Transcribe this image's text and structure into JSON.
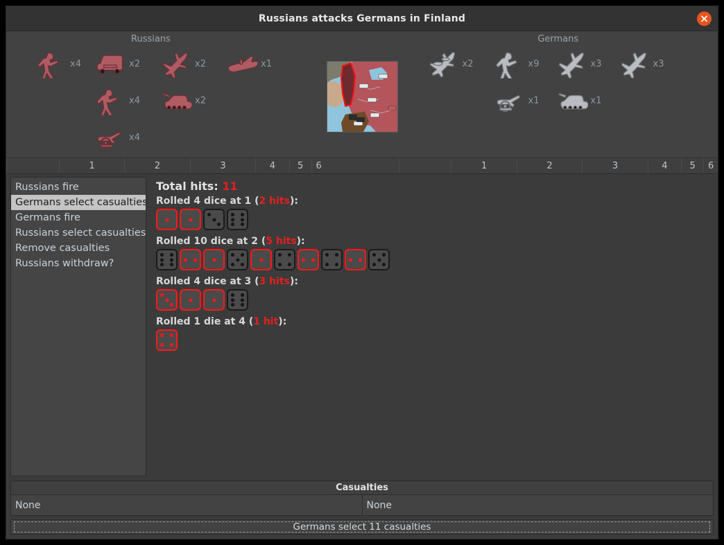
{
  "window": {
    "title": "Russians attacks Germans in Finland",
    "close_icon": "close-icon",
    "close_color": "#e8541f"
  },
  "board": {
    "attacker": {
      "name": "Russians",
      "color": "#b05b62",
      "units": [
        {
          "icon": "infantry-icon",
          "count": "x4",
          "col": 0,
          "row": 0
        },
        {
          "icon": "artillery-truck-icon",
          "count": "x2",
          "col": 1,
          "row": 0
        },
        {
          "icon": "fighter-icon",
          "count": "x2",
          "col": 2,
          "row": 0
        },
        {
          "icon": "submarine-icon",
          "count": "x1",
          "col": 3,
          "row": 0
        },
        {
          "icon": "infantry-icon",
          "count": "x4",
          "col": 1,
          "row": 1
        },
        {
          "icon": "tank-icon",
          "count": "x2",
          "col": 2,
          "row": 1
        },
        {
          "icon": "artillery-icon",
          "count": "x4",
          "col": 1,
          "row": 2
        }
      ]
    },
    "defender": {
      "name": "Germans",
      "color": "#b9bcc0",
      "units": [
        {
          "icon": "bomber-icon",
          "count": "x2",
          "col": 0,
          "row": 0
        },
        {
          "icon": "infantry-icon",
          "count": "x9",
          "col": 1,
          "row": 0
        },
        {
          "icon": "fighter-icon",
          "count": "x3",
          "col": 2,
          "row": 0
        },
        {
          "icon": "fighter-icon",
          "count": "x3",
          "col": 3,
          "row": 0
        },
        {
          "icon": "artillery-icon",
          "count": "x1",
          "col": 1,
          "row": 1
        },
        {
          "icon": "tank-icon",
          "count": "x1",
          "col": 2,
          "row": 1
        }
      ]
    },
    "map_thumbnail": {
      "name": "battle-territory-map",
      "territory": "Finland"
    },
    "scale_labels": [
      "1",
      "2",
      "3",
      "4",
      "5",
      "6"
    ]
  },
  "steps": [
    {
      "label": "Russians fire",
      "selected": false
    },
    {
      "label": "Germans select casualties",
      "selected": true
    },
    {
      "label": "Germans fire",
      "selected": false
    },
    {
      "label": "Russians select casualties",
      "selected": false
    },
    {
      "label": "Remove casualties",
      "selected": false
    },
    {
      "label": "Russians withdraw?",
      "selected": false
    }
  ],
  "results": {
    "total_hits_label": "Total hits:",
    "total_hits_value": "11",
    "hit_color": "#e61f1f",
    "rolls": [
      {
        "label_prefix": "Rolled 4 dice at 1 (",
        "hits_text": "2 hits",
        "label_suffix": "):",
        "dice": [
          {
            "value": 1,
            "hit": true
          },
          {
            "value": 1,
            "hit": true
          },
          {
            "value": 3,
            "hit": false
          },
          {
            "value": 6,
            "hit": false
          }
        ]
      },
      {
        "label_prefix": "Rolled 10 dice at 2 (",
        "hits_text": "5 hits",
        "label_suffix": "):",
        "dice": [
          {
            "value": 6,
            "hit": false
          },
          {
            "value": 2,
            "hit": true
          },
          {
            "value": 1,
            "hit": true
          },
          {
            "value": 5,
            "hit": false
          },
          {
            "value": 1,
            "hit": true
          },
          {
            "value": 4,
            "hit": false
          },
          {
            "value": 2,
            "hit": true
          },
          {
            "value": 4,
            "hit": false
          },
          {
            "value": 2,
            "hit": true
          },
          {
            "value": 5,
            "hit": false
          }
        ]
      },
      {
        "label_prefix": "Rolled 4 dice at 3 (",
        "hits_text": "3 hits",
        "label_suffix": "):",
        "dice": [
          {
            "value": 3,
            "hit": true
          },
          {
            "value": 1,
            "hit": true
          },
          {
            "value": 1,
            "hit": true
          },
          {
            "value": 6,
            "hit": false
          }
        ]
      },
      {
        "label_prefix": "Rolled 1 die at 4 (",
        "hits_text": "1 hit",
        "label_suffix": "):",
        "dice": [
          {
            "value": 4,
            "hit": true
          }
        ]
      }
    ]
  },
  "casualties": {
    "header": "Casualties",
    "left_value": "None",
    "right_value": "None"
  },
  "status": {
    "message": "Germans select 11 casualties"
  }
}
